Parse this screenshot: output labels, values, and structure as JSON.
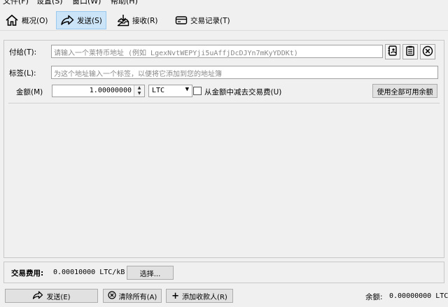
{
  "menu": {
    "file": "文件(F)",
    "settings": "设置(S)",
    "window": "窗口(W)",
    "help": "帮助(H)"
  },
  "tabs": {
    "overview": "概况(O)",
    "send": "发送(S)",
    "receive": "接收(R)",
    "transactions": "交易记录(T)"
  },
  "form": {
    "pay_to_label": "付给(T):",
    "pay_to_placeholder": "请输入一个莱特币地址 (例如 LgexNvtWEPYji5uAffjDcDJYn7mKyYDDKt)",
    "label_label": "标签(L):",
    "label_placeholder": "为这个地址输入一个标签，以便将它添加到您的地址簿",
    "amount_label": "金额(M)",
    "amount_value": "1.00000000",
    "unit": "LTC",
    "subtract_fee_label": "从金额中减去交易费(U)",
    "use_available_label": "使用全部可用余额"
  },
  "fee": {
    "label": "交易费用:",
    "value": "0.00010000 LTC/kB",
    "choose_label": "选择..."
  },
  "actions": {
    "send": "发送(E)",
    "clear_all": "清除所有(A)",
    "add_recipient": "添加收款人(R)"
  },
  "balance": {
    "label": "余额:",
    "value": "0.00000000 LTC"
  }
}
